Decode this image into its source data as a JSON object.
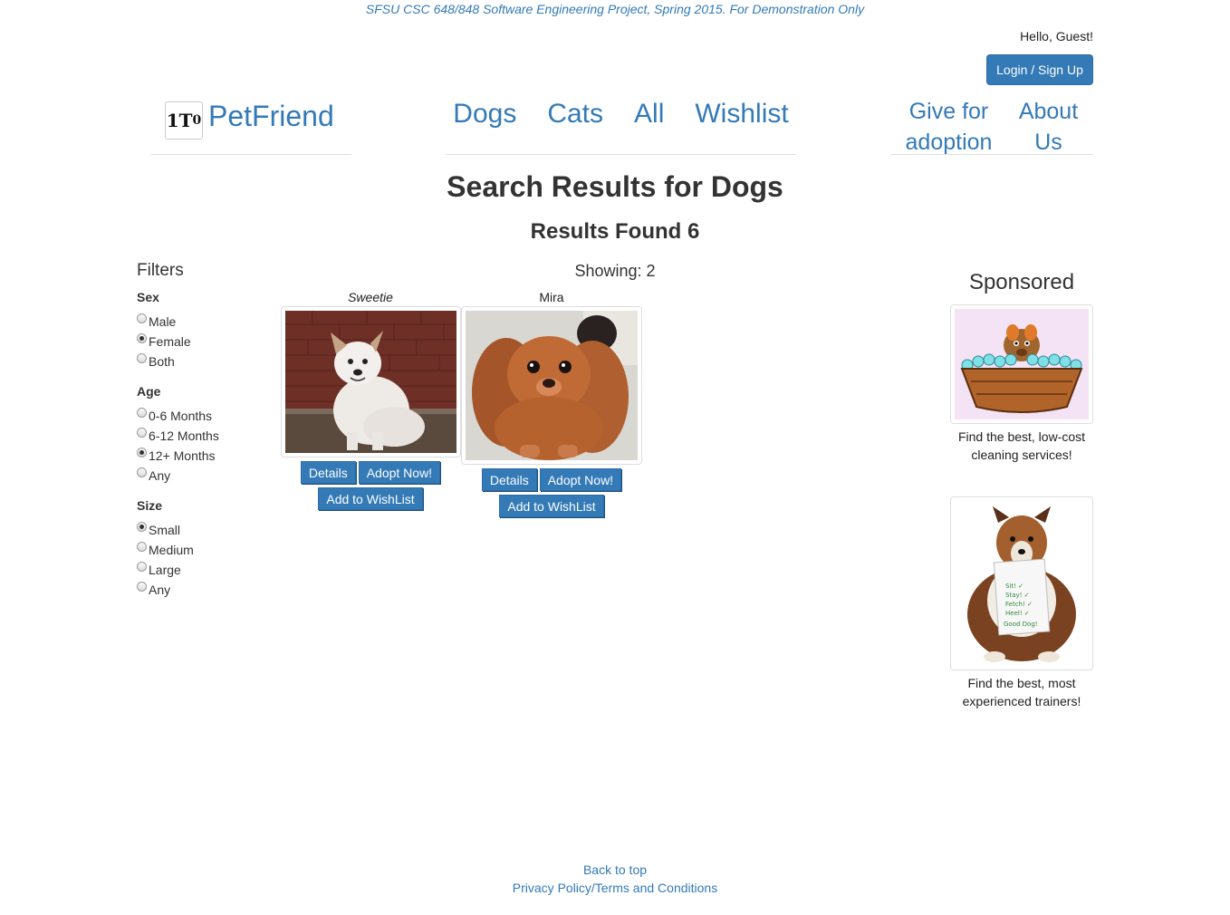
{
  "banner": "SFSU CSC 648/848 Software Engineering Project, Spring 2015. For Demonstration Only",
  "header": {
    "greeting": "Hello, Guest!",
    "login_label": "Login / Sign Up",
    "brand_name": "PetFriend",
    "logo_icon": "petfriend-logo-icon",
    "nav": [
      "Dogs",
      "Cats",
      "All",
      "Wishlist"
    ],
    "side_nav": [
      "Give for adoption",
      "About Us"
    ]
  },
  "search": {
    "title": "Search Results for Dogs",
    "results_found": "Results Found 6",
    "showing": "Showing: 2"
  },
  "filters": {
    "title": "Filters",
    "sex": {
      "label": "Sex",
      "options": [
        "Male",
        "Female",
        "Both"
      ],
      "selected": "Female"
    },
    "age": {
      "label": "Age",
      "options": [
        "0-6 Months",
        "6-12 Months",
        "12+ Months",
        "Any"
      ],
      "selected": "12+ Months"
    },
    "size": {
      "label": "Size",
      "options": [
        "Small",
        "Medium",
        "Large",
        "Any"
      ],
      "selected": "Small"
    }
  },
  "pets": [
    {
      "name": "Sweetie",
      "details": "Details",
      "adopt": "Adopt Now!",
      "wishlist": "Add to WishList"
    },
    {
      "name": "Mira",
      "details": "Details",
      "adopt": "Adopt Now!",
      "wishlist": "Add to WishList"
    }
  ],
  "sponsored": {
    "title": "Sponsored",
    "ads": [
      {
        "caption": "Find the best, low-cost cleaning services!"
      },
      {
        "caption": "Find the best, most experienced trainers!"
      }
    ]
  },
  "footer": {
    "back_to_top": "Back to top",
    "privacy": "Privacy Policy/Terms and Conditions"
  }
}
